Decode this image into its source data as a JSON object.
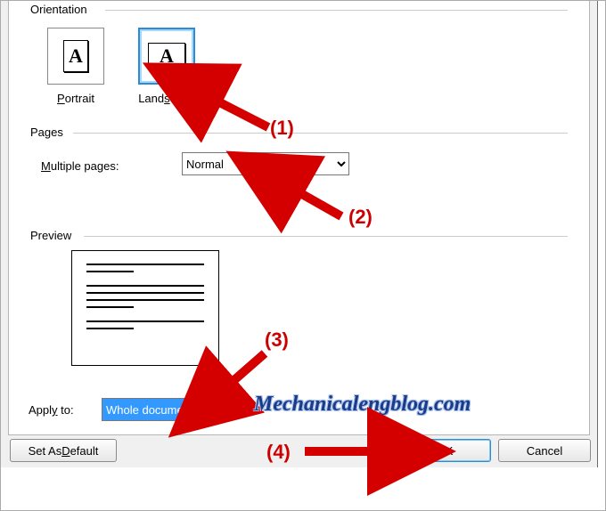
{
  "orientation": {
    "group_label": "Orientation",
    "portrait_label": "Portrait",
    "landscape_label": "Landscape",
    "glyph": "A"
  },
  "pages": {
    "group_label": "Pages",
    "multiple_label": "Multiple pages:",
    "multiple_value": "Normal"
  },
  "preview": {
    "group_label": "Preview"
  },
  "apply": {
    "label": "Apply to:",
    "value": "Whole document"
  },
  "buttons": {
    "set_default": "Set As Default",
    "ok": "OK",
    "cancel": "Cancel"
  },
  "annotations": {
    "n1": "(1)",
    "n2": "(2)",
    "n3": "(3)",
    "n4": "(4)",
    "watermark": "Mechanicalengblog.com"
  }
}
